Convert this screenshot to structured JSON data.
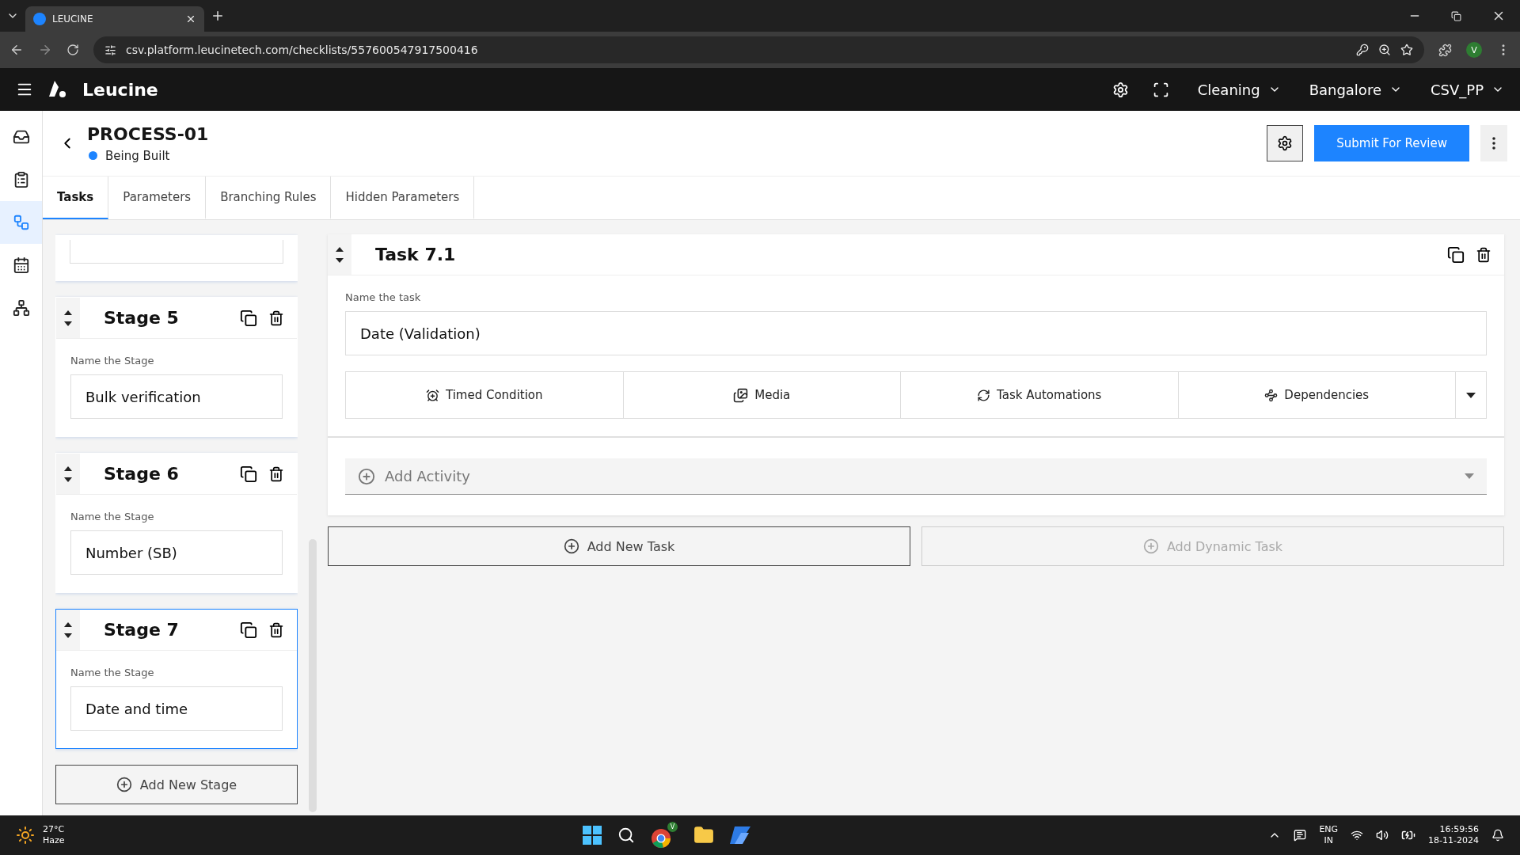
{
  "browser": {
    "tab_title": "LEUCINE",
    "url": "csv.platform.leucinetech.com/checklists/557600547917500416",
    "profile_initial": "V"
  },
  "app_header": {
    "brand": "Leucine",
    "selectors": [
      "Cleaning",
      "Bangalore",
      "CSV_PP"
    ]
  },
  "rail": [
    {
      "kind": "inbox",
      "selected": false
    },
    {
      "kind": "checklist",
      "selected": false
    },
    {
      "kind": "process",
      "selected": true
    },
    {
      "kind": "calendar",
      "selected": false
    },
    {
      "kind": "hierarchy",
      "selected": false
    }
  ],
  "page_header": {
    "title": "PROCESS-01",
    "status": "Being Built",
    "primary_button": "Submit For Review"
  },
  "tabs": [
    {
      "label": "Tasks",
      "selected": true
    },
    {
      "label": "Parameters",
      "selected": false
    },
    {
      "label": "Branching Rules",
      "selected": false
    },
    {
      "label": "Hidden Parameters",
      "selected": false
    }
  ],
  "stages": [
    {
      "title": "Stage 5",
      "label": "Name the Stage",
      "value": "Bulk verification",
      "selected": false
    },
    {
      "title": "Stage 6",
      "label": "Name the Stage",
      "value": "Number (SB)",
      "selected": false
    },
    {
      "title": "Stage 7",
      "label": "Name the Stage",
      "value": "Date and time",
      "selected": true
    }
  ],
  "add_stage": "Add New Stage",
  "task": {
    "title": "Task 7.1",
    "label": "Name the task",
    "value": "Date (Validation)",
    "options": [
      {
        "kind": "timer",
        "label": "Timed Condition"
      },
      {
        "kind": "media",
        "label": "Media"
      },
      {
        "kind": "automation",
        "label": "Task Automations"
      },
      {
        "kind": "dependency",
        "label": "Dependencies"
      }
    ],
    "add_activity": "Add Activity"
  },
  "task_buttons": [
    {
      "label": "Add New Task",
      "disabled": false
    },
    {
      "label": "Add Dynamic Task",
      "disabled": true
    }
  ],
  "taskbar": {
    "temperature": "27°C",
    "weather": "Haze",
    "chrome_badge": "V",
    "lang": "ENG",
    "region": "IN",
    "time": "16:59:56",
    "date": "18-11-2024"
  }
}
